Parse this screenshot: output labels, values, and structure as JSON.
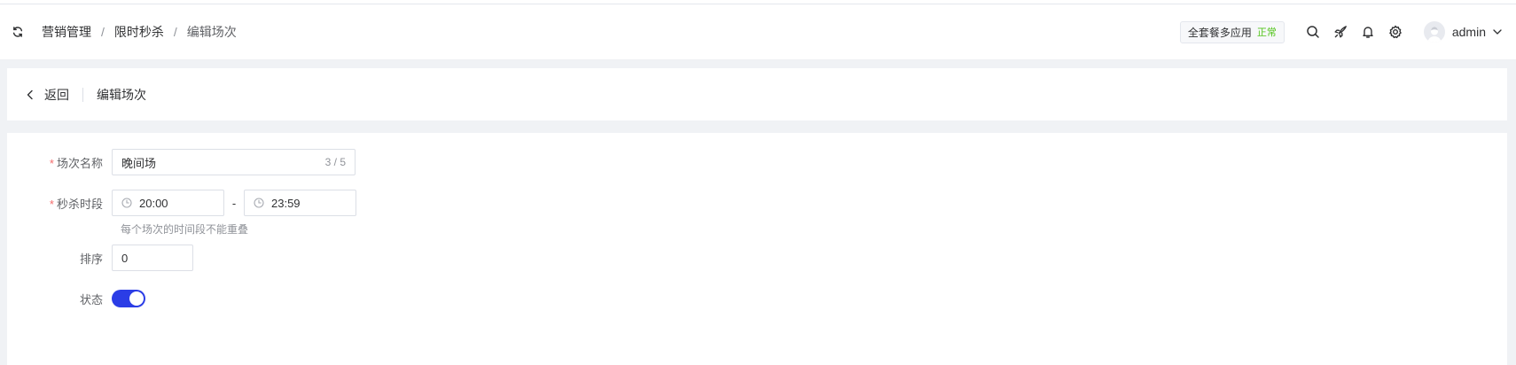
{
  "breadcrumb": [
    "营销管理",
    "限时秒杀",
    "编辑场次"
  ],
  "breadcrumb_sep": "/",
  "header": {
    "plan_label": "全套餐多应用",
    "plan_status": "正常",
    "username": "admin",
    "icons": [
      "search-icon",
      "rocket-icon",
      "bell-icon",
      "gear-icon"
    ]
  },
  "backbar": {
    "back_label": "返回",
    "title": "编辑场次"
  },
  "form": {
    "name": {
      "label": "场次名称",
      "value": "晚间场",
      "count": "3 / 5",
      "required": true
    },
    "time": {
      "label": "秒杀时段",
      "start": "20:00",
      "end": "23:59",
      "separator": "-",
      "hint": "每个场次的时间段不能重叠",
      "required": true
    },
    "sort": {
      "label": "排序",
      "value": "0"
    },
    "status": {
      "label": "状态",
      "on": true
    }
  },
  "colors": {
    "accent": "#2b3de6",
    "required": "#f56c6c",
    "status_ok": "#52c41a",
    "page_bg": "#f0f2f5"
  }
}
